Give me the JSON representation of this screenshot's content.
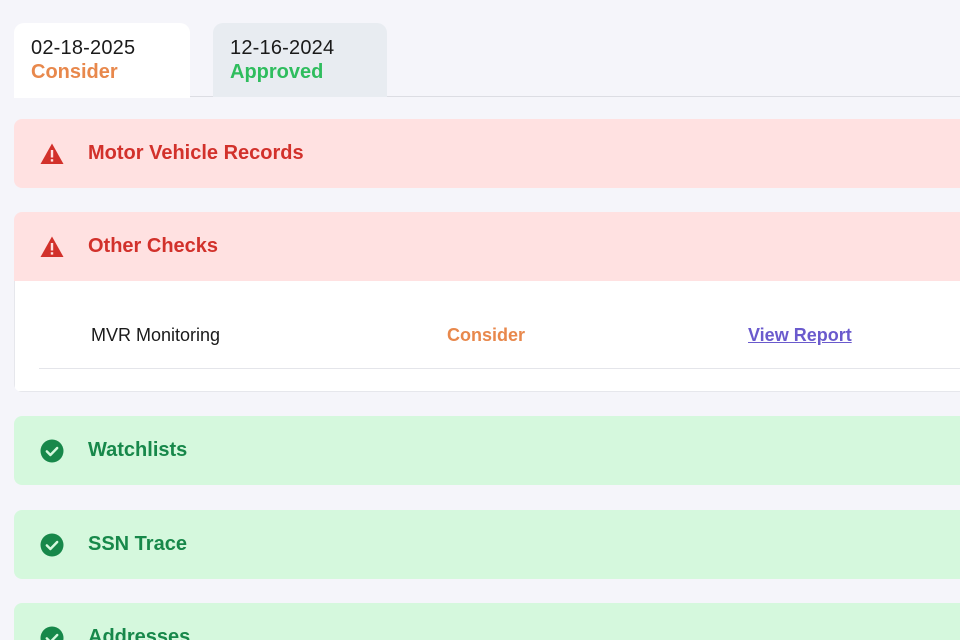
{
  "tabs": [
    {
      "date": "02-18-2025",
      "status": "Consider"
    },
    {
      "date": "12-16-2024",
      "status": "Approved"
    }
  ],
  "sections": {
    "motor_vehicle_records": {
      "title": "Motor Vehicle Records",
      "state": "alert",
      "icon": "warning-icon"
    },
    "other_checks": {
      "title": "Other Checks",
      "state": "alert",
      "icon": "warning-icon",
      "rows": [
        {
          "name": "MVR Monitoring",
          "status": "Consider",
          "link": "View Report"
        }
      ]
    },
    "watchlists": {
      "title": "Watchlists",
      "state": "ok",
      "icon": "check-circle-icon"
    },
    "ssn_trace": {
      "title": "SSN Trace",
      "state": "ok",
      "icon": "check-circle-icon"
    },
    "addresses": {
      "title": "Addresses",
      "state": "ok",
      "icon": "check-circle-icon"
    }
  },
  "colors": {
    "background": "#f5f5fa",
    "alert_bg": "#ffe1e1",
    "alert_text": "#d2312b",
    "ok_bg": "#d5f8dd",
    "ok_text": "#17884a",
    "consider": "#e8884c",
    "approved": "#2fbd5e",
    "link": "#6a5acd"
  }
}
